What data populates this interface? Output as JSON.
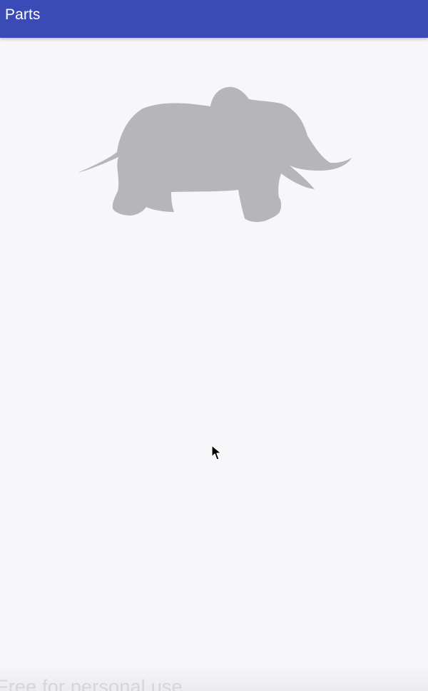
{
  "app_bar": {
    "title": "Parts",
    "background": "#3a4bb7"
  },
  "content": {
    "placeholder_image": {
      "icon": "elephant-icon",
      "color": "#b6b5b8"
    },
    "cursor_icon": "pointer-arrow-icon"
  },
  "footer": {
    "watermark_text": "Free for personal use"
  }
}
